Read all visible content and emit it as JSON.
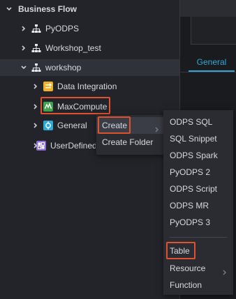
{
  "tree": {
    "root": {
      "label": "Business Flow",
      "icon": "chevron-down-icon"
    },
    "flows": [
      {
        "label": "PyODPS",
        "icon": "workflow-icon",
        "expanded": false
      },
      {
        "label": "Workshop_test",
        "icon": "workflow-icon",
        "expanded": false
      },
      {
        "label": "workshop",
        "icon": "workflow-icon",
        "expanded": true
      }
    ],
    "children": [
      {
        "label": "Data Integration",
        "icon": "data-integration-icon"
      },
      {
        "label": "MaxCompute",
        "icon": "maxcompute-icon"
      },
      {
        "label": "General",
        "icon": "general-icon"
      },
      {
        "label": "UserDefined",
        "icon": "user-defined-icon"
      }
    ]
  },
  "context_menu": {
    "items": [
      {
        "label": "Create",
        "has_submenu": true
      },
      {
        "label": "Create Folder",
        "has_submenu": false
      }
    ]
  },
  "submenu": {
    "items": [
      {
        "label": "ODPS SQL"
      },
      {
        "label": "SQL Snippet"
      },
      {
        "label": "ODPS Spark"
      },
      {
        "label": "PyODPS 2"
      },
      {
        "label": "ODPS Script"
      },
      {
        "label": "ODPS MR"
      },
      {
        "label": "PyODPS 3"
      },
      {
        "label": "Table"
      },
      {
        "label": "Resource",
        "has_submenu": true
      },
      {
        "label": "Function"
      }
    ]
  },
  "right_panel": {
    "tab_label": "General"
  },
  "colors": {
    "accent": "#2ea9d6",
    "highlight": "#e0522f",
    "data_integration": "#f2b024",
    "maxcompute": "#3fa34d",
    "general": "#2ea9d6",
    "user_defined": "#8e6fd8"
  }
}
